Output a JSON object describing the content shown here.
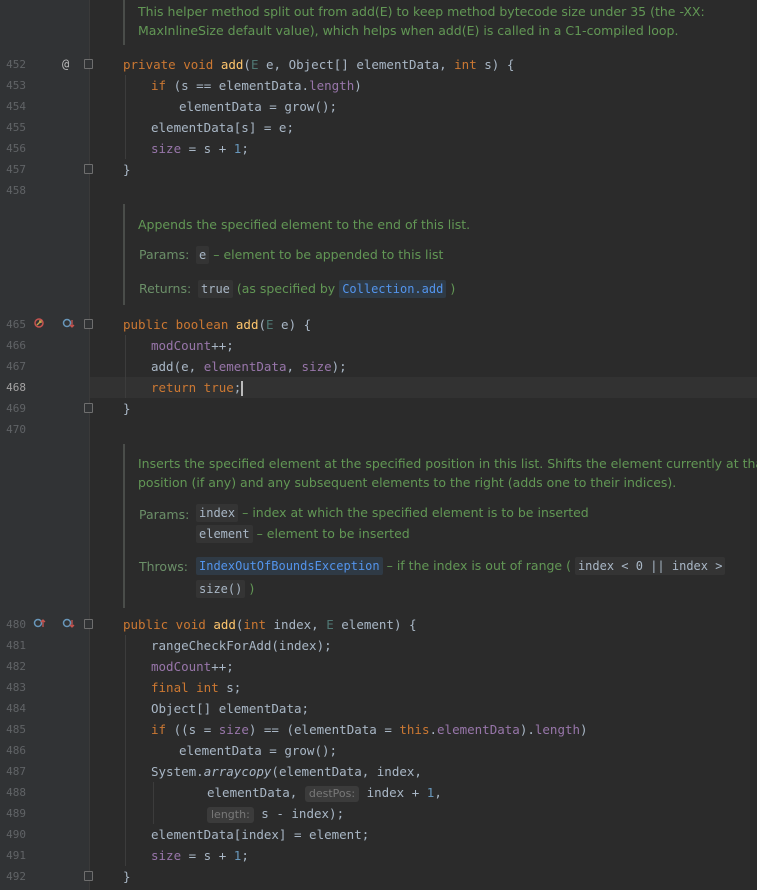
{
  "doc_top": "This helper method split out from add(E) to keep method bytecode size under 35 (the -XX: MaxInlineSize default value), which helps when add(E) is called in a C1-compiled loop.",
  "doc_top_line1": "This helper method split out from add(E) to keep method bytecode size under 35 (the -XX:",
  "doc_top_line2": "MaxInlineSize default value), which helps when add(E) is called in a C1-compiled loop.",
  "doc_add": {
    "text": "Appends the specified element to the end of this list.",
    "params_label": "Params:",
    "param_name": "e",
    "param_desc": "– element to be appended to this list",
    "returns_label": "Returns:",
    "returns_value": "true",
    "returns_mid": "(as specified by",
    "returns_link": "Collection.add",
    "returns_end": ")"
  },
  "doc_insert": {
    "line1": "Inserts the specified element at the specified position in this list. Shifts the element currently at that",
    "line2": "position (if any) and any subsequent elements to the right (adds one to their indices).",
    "params_label": "Params:",
    "p1_name": "index",
    "p1_desc": "– index at which the specified element is to be inserted",
    "p2_name": "element",
    "p2_desc": "– element to be inserted",
    "throws_label": "Throws:",
    "throws_link": "IndexOutOfBoundsException",
    "throws_desc": "– if the index is out of range (",
    "throws_expr": "index < 0 || index >",
    "throws_expr2": "size()",
    "throws_end": ")"
  },
  "line_numbers": {
    "l452": "452",
    "l453": "453",
    "l454": "454",
    "l455": "455",
    "l456": "456",
    "l457": "457",
    "l458": "458",
    "l465": "465",
    "l466": "466",
    "l467": "467",
    "l468": "468",
    "l469": "469",
    "l470": "470",
    "l480": "480",
    "l481": "481",
    "l482": "482",
    "l483": "483",
    "l484": "484",
    "l485": "485",
    "l486": "486",
    "l487": "487",
    "l488": "488",
    "l489": "489",
    "l490": "490",
    "l491": "491",
    "l492": "492"
  },
  "hints": {
    "destPos": "destPos:",
    "length": "length:"
  },
  "gutter_icons": {
    "at": "@",
    "implements": "implements-icon",
    "overrides": "overrides-icon",
    "override_down": "override-down-icon"
  },
  "colors": {
    "background": "#2b2b2b",
    "keyword": "#cc7832",
    "method": "#ffc66d",
    "field": "#9876aa",
    "number": "#6897bb",
    "doc": "#629755"
  }
}
